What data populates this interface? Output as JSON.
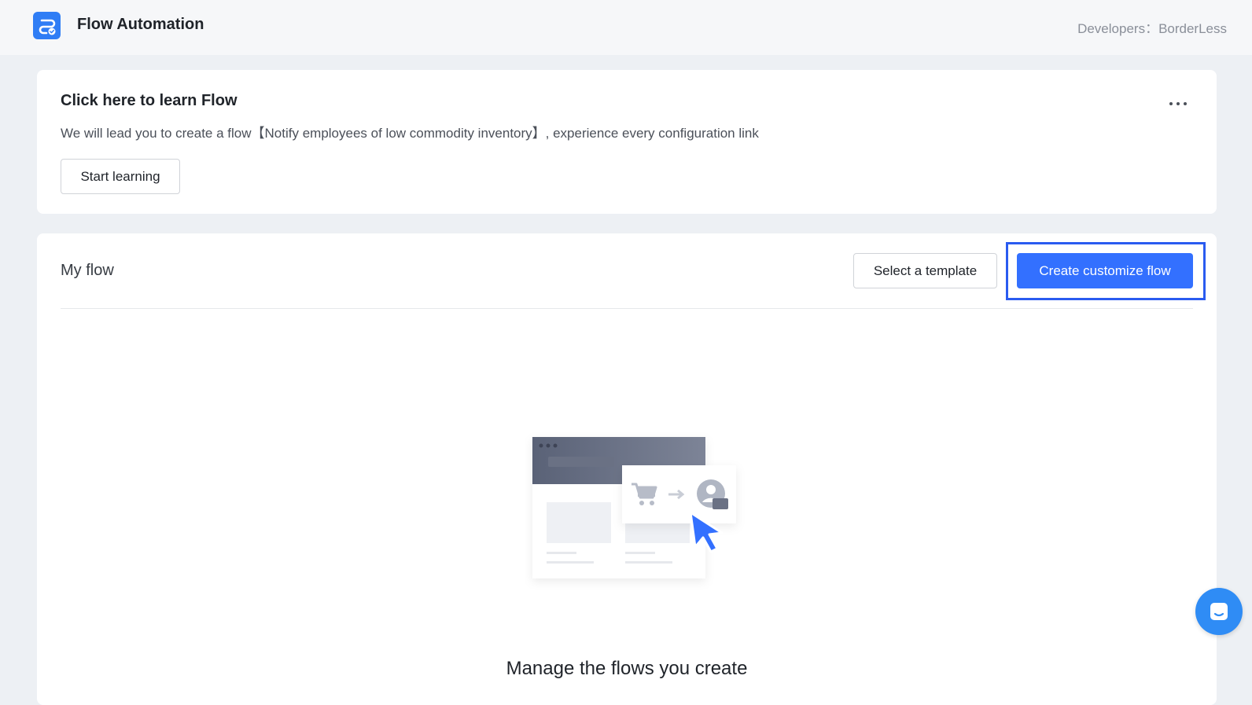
{
  "header": {
    "app_title": "Flow Automation",
    "developer_label": "Developers：BorderLess",
    "logo_icon": "flow-logo-icon",
    "brand_color": "#2f7df5"
  },
  "learn_card": {
    "title": "Click here to learn Flow",
    "description": "We will lead you to create a flow【Notify employees of low commodity inventory】, experience every configuration link",
    "start_button_label": "Start learning",
    "more_icon": "more-horizontal-icon"
  },
  "my_flow": {
    "title": "My flow",
    "select_template_label": "Select a template",
    "create_flow_label": "Create customize flow",
    "empty_state_title": "Manage the flows you create",
    "accent_color": "#3370ff"
  },
  "chat_widget": {
    "icon": "chat-icon",
    "color": "#2f8cf5"
  }
}
